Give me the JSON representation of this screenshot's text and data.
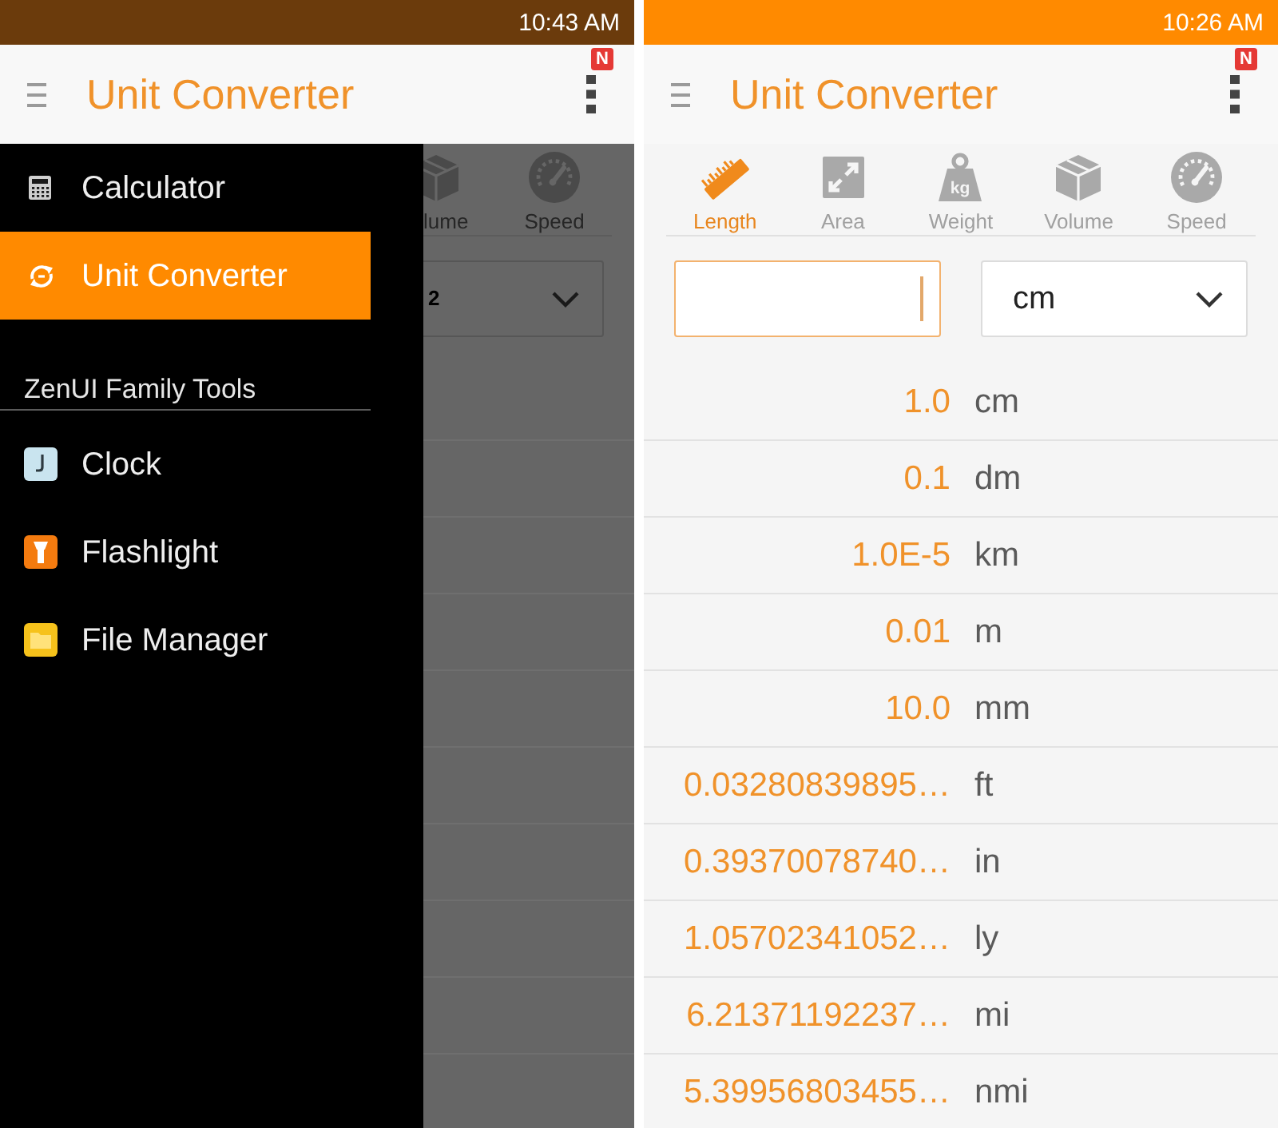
{
  "left_screen": {
    "status_bar": {
      "time": "10:43 AM"
    },
    "app_bar": {
      "title": "Unit Converter",
      "badge": "N"
    },
    "drawer": {
      "items": [
        {
          "label": "Calculator",
          "selected": false
        },
        {
          "label": "Unit Converter",
          "selected": true
        }
      ],
      "section_title": "ZenUI Family Tools",
      "tools": [
        {
          "label": "Clock"
        },
        {
          "label": "Flashlight"
        },
        {
          "label": "File Manager"
        }
      ]
    },
    "background": {
      "tabs": [
        {
          "label": "lume",
          "selected": false
        },
        {
          "label": "Speed",
          "selected": false
        }
      ],
      "unit_select": {
        "value": "2"
      }
    }
  },
  "right_screen": {
    "status_bar": {
      "time": "10:26 AM"
    },
    "app_bar": {
      "title": "Unit Converter",
      "badge": "N"
    },
    "tabs": [
      {
        "label": "Length",
        "selected": true
      },
      {
        "label": "Area",
        "selected": false
      },
      {
        "label": "Weight",
        "selected": false,
        "icon_text": "kg"
      },
      {
        "label": "Volume",
        "selected": false
      },
      {
        "label": "Speed",
        "selected": false
      }
    ],
    "amount_field": {
      "focused": true
    },
    "unit_select": {
      "value": "cm"
    },
    "results": [
      {
        "value": "1.0",
        "unit": "cm"
      },
      {
        "value": "0.1",
        "unit": "dm"
      },
      {
        "value": "1.0E-5",
        "unit": "km"
      },
      {
        "value": "0.01",
        "unit": "m"
      },
      {
        "value": "10.0",
        "unit": "mm"
      },
      {
        "value": "0.03280839895…",
        "unit": "ft"
      },
      {
        "value": "0.39370078740…",
        "unit": "in"
      },
      {
        "value": "1.05702341052…",
        "unit": "ly"
      },
      {
        "value": "6.21371192237…",
        "unit": "mi"
      },
      {
        "value": "5.39956803455…",
        "unit": "nmi"
      }
    ]
  }
}
